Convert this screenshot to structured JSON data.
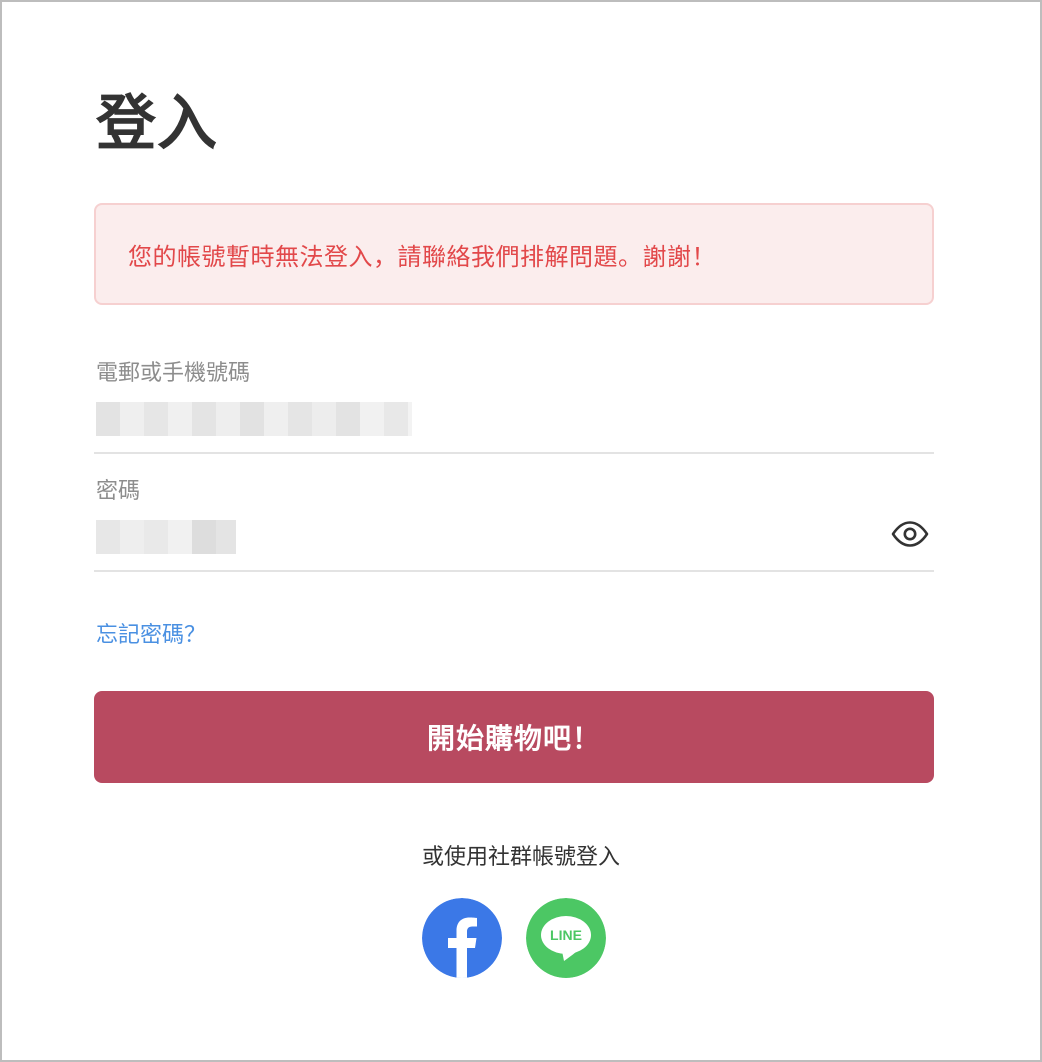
{
  "page": {
    "title": "登入"
  },
  "alert": {
    "message": "您的帳號暫時無法登入，請聯絡我們排解問題。謝謝！",
    "color": "#e2484a",
    "background": "#fbeded"
  },
  "form": {
    "email": {
      "label": "電郵或手機號碼",
      "value": ""
    },
    "password": {
      "label": "密碼",
      "value": ""
    },
    "forgot_label": "忘記密碼？",
    "submit_label": "開始購物吧！",
    "submit_color": "#b84a60"
  },
  "social": {
    "caption": "或使用社群帳號登入",
    "facebook": {
      "icon": "facebook-icon",
      "color": "#3b78e7"
    },
    "line": {
      "icon": "line-icon",
      "label": "LINE",
      "color": "#4cc764"
    }
  },
  "icons": {
    "eye": "eye-icon"
  }
}
